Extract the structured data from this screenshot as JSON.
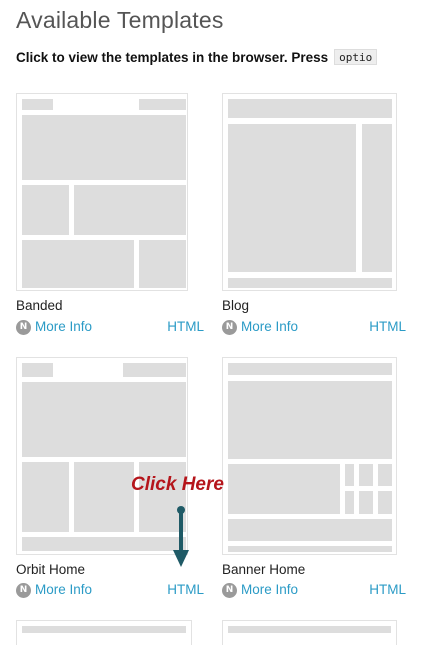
{
  "page": {
    "title": "Available Templates",
    "instructions": "Click to view the templates in the browser. Press",
    "instructions_key": "optio"
  },
  "templates": [
    {
      "name": "Banded",
      "more_info": "More Info",
      "html": "HTML",
      "icon": "N"
    },
    {
      "name": "Blog",
      "more_info": "More Info",
      "html": "HTML",
      "icon": "N"
    },
    {
      "name": "Orbit Home",
      "more_info": "More Info",
      "html": "HTML",
      "icon": "N"
    },
    {
      "name": "Banner Home",
      "more_info": "More Info",
      "html": "HTML",
      "icon": "N"
    }
  ],
  "callout": {
    "text": "Click Here",
    "color": "#b5151b",
    "arrow_color": "#1f5a66"
  },
  "colors": {
    "link": "#2b9bc6",
    "placeholder": "#dddddd",
    "icon_badge": "#9a9a9a"
  }
}
